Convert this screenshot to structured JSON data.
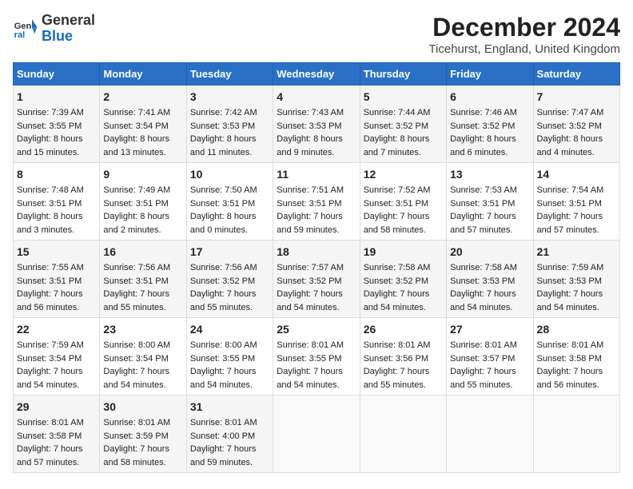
{
  "logo": {
    "line1": "General",
    "line2": "Blue"
  },
  "title": "December 2024",
  "subtitle": "Ticehurst, England, United Kingdom",
  "days_of_week": [
    "Sunday",
    "Monday",
    "Tuesday",
    "Wednesday",
    "Thursday",
    "Friday",
    "Saturday"
  ],
  "weeks": [
    [
      {
        "day": "1",
        "sunrise": "7:39 AM",
        "sunset": "3:55 PM",
        "daylight": "8 hours and 15 minutes."
      },
      {
        "day": "2",
        "sunrise": "7:41 AM",
        "sunset": "3:54 PM",
        "daylight": "8 hours and 13 minutes."
      },
      {
        "day": "3",
        "sunrise": "7:42 AM",
        "sunset": "3:53 PM",
        "daylight": "8 hours and 11 minutes."
      },
      {
        "day": "4",
        "sunrise": "7:43 AM",
        "sunset": "3:53 PM",
        "daylight": "8 hours and 9 minutes."
      },
      {
        "day": "5",
        "sunrise": "7:44 AM",
        "sunset": "3:52 PM",
        "daylight": "8 hours and 7 minutes."
      },
      {
        "day": "6",
        "sunrise": "7:46 AM",
        "sunset": "3:52 PM",
        "daylight": "8 hours and 6 minutes."
      },
      {
        "day": "7",
        "sunrise": "7:47 AM",
        "sunset": "3:52 PM",
        "daylight": "8 hours and 4 minutes."
      }
    ],
    [
      {
        "day": "8",
        "sunrise": "7:48 AM",
        "sunset": "3:51 PM",
        "daylight": "8 hours and 3 minutes."
      },
      {
        "day": "9",
        "sunrise": "7:49 AM",
        "sunset": "3:51 PM",
        "daylight": "8 hours and 2 minutes."
      },
      {
        "day": "10",
        "sunrise": "7:50 AM",
        "sunset": "3:51 PM",
        "daylight": "8 hours and 0 minutes."
      },
      {
        "day": "11",
        "sunrise": "7:51 AM",
        "sunset": "3:51 PM",
        "daylight": "7 hours and 59 minutes."
      },
      {
        "day": "12",
        "sunrise": "7:52 AM",
        "sunset": "3:51 PM",
        "daylight": "7 hours and 58 minutes."
      },
      {
        "day": "13",
        "sunrise": "7:53 AM",
        "sunset": "3:51 PM",
        "daylight": "7 hours and 57 minutes."
      },
      {
        "day": "14",
        "sunrise": "7:54 AM",
        "sunset": "3:51 PM",
        "daylight": "7 hours and 57 minutes."
      }
    ],
    [
      {
        "day": "15",
        "sunrise": "7:55 AM",
        "sunset": "3:51 PM",
        "daylight": "7 hours and 56 minutes."
      },
      {
        "day": "16",
        "sunrise": "7:56 AM",
        "sunset": "3:51 PM",
        "daylight": "7 hours and 55 minutes."
      },
      {
        "day": "17",
        "sunrise": "7:56 AM",
        "sunset": "3:52 PM",
        "daylight": "7 hours and 55 minutes."
      },
      {
        "day": "18",
        "sunrise": "7:57 AM",
        "sunset": "3:52 PM",
        "daylight": "7 hours and 54 minutes."
      },
      {
        "day": "19",
        "sunrise": "7:58 AM",
        "sunset": "3:52 PM",
        "daylight": "7 hours and 54 minutes."
      },
      {
        "day": "20",
        "sunrise": "7:58 AM",
        "sunset": "3:53 PM",
        "daylight": "7 hours and 54 minutes."
      },
      {
        "day": "21",
        "sunrise": "7:59 AM",
        "sunset": "3:53 PM",
        "daylight": "7 hours and 54 minutes."
      }
    ],
    [
      {
        "day": "22",
        "sunrise": "7:59 AM",
        "sunset": "3:54 PM",
        "daylight": "7 hours and 54 minutes."
      },
      {
        "day": "23",
        "sunrise": "8:00 AM",
        "sunset": "3:54 PM",
        "daylight": "7 hours and 54 minutes."
      },
      {
        "day": "24",
        "sunrise": "8:00 AM",
        "sunset": "3:55 PM",
        "daylight": "7 hours and 54 minutes."
      },
      {
        "day": "25",
        "sunrise": "8:01 AM",
        "sunset": "3:55 PM",
        "daylight": "7 hours and 54 minutes."
      },
      {
        "day": "26",
        "sunrise": "8:01 AM",
        "sunset": "3:56 PM",
        "daylight": "7 hours and 55 minutes."
      },
      {
        "day": "27",
        "sunrise": "8:01 AM",
        "sunset": "3:57 PM",
        "daylight": "7 hours and 55 minutes."
      },
      {
        "day": "28",
        "sunrise": "8:01 AM",
        "sunset": "3:58 PM",
        "daylight": "7 hours and 56 minutes."
      }
    ],
    [
      {
        "day": "29",
        "sunrise": "8:01 AM",
        "sunset": "3:58 PM",
        "daylight": "7 hours and 57 minutes."
      },
      {
        "day": "30",
        "sunrise": "8:01 AM",
        "sunset": "3:59 PM",
        "daylight": "7 hours and 58 minutes."
      },
      {
        "day": "31",
        "sunrise": "8:01 AM",
        "sunset": "4:00 PM",
        "daylight": "7 hours and 59 minutes."
      },
      null,
      null,
      null,
      null
    ]
  ],
  "labels": {
    "sunrise": "Sunrise: ",
    "sunset": "Sunset: ",
    "daylight": "Daylight: "
  }
}
